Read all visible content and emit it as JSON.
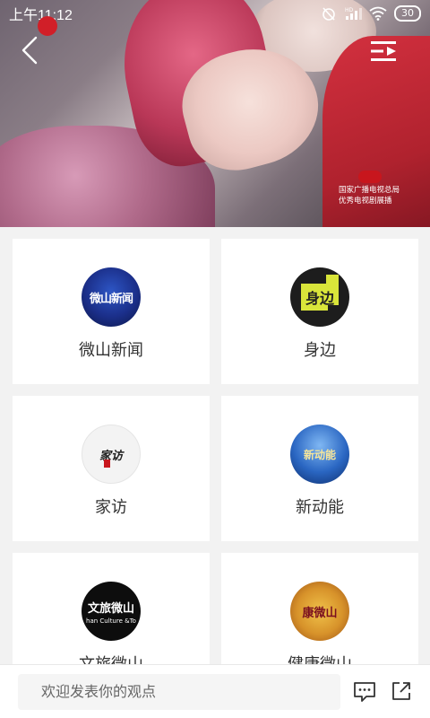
{
  "status_bar": {
    "time": "上午11:12",
    "battery": "30",
    "icons": [
      "alarm-off-icon",
      "hd-signal-icon",
      "wifi-icon",
      "battery-icon"
    ]
  },
  "video": {
    "watermark_line1": "国家广播电视总局",
    "watermark_line2": "优秀电视剧展播",
    "overlay_icons": [
      "back-arrow-icon",
      "playlist-icon"
    ]
  },
  "channels": [
    {
      "label": "微山新闻",
      "logo_text": "微山新闻"
    },
    {
      "label": "身边",
      "logo_text": "身边"
    },
    {
      "label": "家访",
      "logo_text": "家访"
    },
    {
      "label": "新动能",
      "logo_text": "新动能"
    },
    {
      "label": "文旅微山",
      "logo_text": "文旅微山",
      "logo_subtext": "han Culture &To"
    },
    {
      "label": "健康微山",
      "logo_text": "康微山"
    }
  ],
  "comment_bar": {
    "placeholder": "欢迎发表你的观点",
    "icons": [
      "comment-icon",
      "share-icon"
    ]
  }
}
